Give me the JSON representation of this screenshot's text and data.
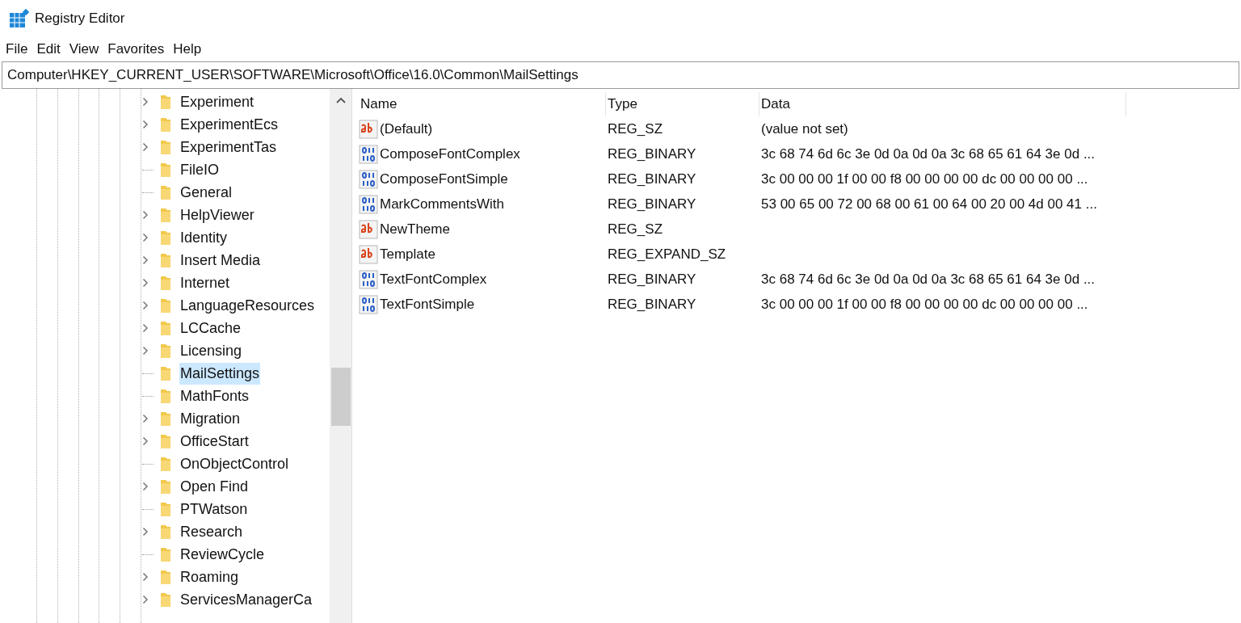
{
  "window": {
    "title": "Registry Editor"
  },
  "menu": [
    "File",
    "Edit",
    "View",
    "Favorites",
    "Help"
  ],
  "address": "Computer\\HKEY_CURRENT_USER\\SOFTWARE\\Microsoft\\Office\\16.0\\Common\\MailSettings",
  "tree": [
    {
      "label": "Experiment",
      "expandable": true,
      "selected": false
    },
    {
      "label": "ExperimentEcs",
      "expandable": true,
      "selected": false
    },
    {
      "label": "ExperimentTas",
      "expandable": true,
      "selected": false
    },
    {
      "label": "FileIO",
      "expandable": false,
      "selected": false
    },
    {
      "label": "General",
      "expandable": false,
      "selected": false
    },
    {
      "label": "HelpViewer",
      "expandable": true,
      "selected": false
    },
    {
      "label": "Identity",
      "expandable": true,
      "selected": false
    },
    {
      "label": "Insert Media",
      "expandable": true,
      "selected": false
    },
    {
      "label": "Internet",
      "expandable": true,
      "selected": false
    },
    {
      "label": "LanguageResources",
      "expandable": true,
      "selected": false
    },
    {
      "label": "LCCache",
      "expandable": true,
      "selected": false
    },
    {
      "label": "Licensing",
      "expandable": true,
      "selected": false
    },
    {
      "label": "MailSettings",
      "expandable": false,
      "selected": true
    },
    {
      "label": "MathFonts",
      "expandable": false,
      "selected": false
    },
    {
      "label": "Migration",
      "expandable": true,
      "selected": false
    },
    {
      "label": "OfficeStart",
      "expandable": true,
      "selected": false
    },
    {
      "label": "OnObjectControl",
      "expandable": false,
      "selected": false
    },
    {
      "label": "Open Find",
      "expandable": true,
      "selected": false
    },
    {
      "label": "PTWatson",
      "expandable": false,
      "selected": false
    },
    {
      "label": "Research",
      "expandable": true,
      "selected": false
    },
    {
      "label": "ReviewCycle",
      "expandable": false,
      "selected": false
    },
    {
      "label": "Roaming",
      "expandable": true,
      "selected": false
    },
    {
      "label": "ServicesManagerCa",
      "expandable": true,
      "selected": false
    }
  ],
  "table": {
    "columns": [
      "Name",
      "Type",
      "Data"
    ],
    "rows": [
      {
        "kind": "string",
        "name": "(Default)",
        "type": "REG_SZ",
        "data": "(value not set)"
      },
      {
        "kind": "binary",
        "name": "ComposeFontComplex",
        "type": "REG_BINARY",
        "data": "3c 68 74 6d 6c 3e 0d 0a 0d 0a 3c 68 65 61 64 3e 0d ..."
      },
      {
        "kind": "binary",
        "name": "ComposeFontSimple",
        "type": "REG_BINARY",
        "data": "3c 00 00 00 1f 00 00 f8 00 00 00 00 dc 00 00 00 00 ..."
      },
      {
        "kind": "binary",
        "name": "MarkCommentsWith",
        "type": "REG_BINARY",
        "data": "53 00 65 00 72 00 68 00 61 00 64 00 20 00 4d 00 41 ..."
      },
      {
        "kind": "string",
        "name": "NewTheme",
        "type": "REG_SZ"
      },
      {
        "kind": "string",
        "name": "Template",
        "type": "REG_EXPAND_SZ"
      },
      {
        "kind": "binary",
        "name": "TextFontComplex",
        "type": "REG_BINARY",
        "data": "3c 68 74 6d 6c 3e 0d 0a 0d 0a 3c 68 65 61 64 3e 0d ..."
      },
      {
        "kind": "binary",
        "name": "TextFontSimple",
        "type": "REG_BINARY",
        "data": "3c 00 00 00 1f 00 00 f8 00 00 00 00 dc 00 00 00 00 ..."
      }
    ]
  }
}
